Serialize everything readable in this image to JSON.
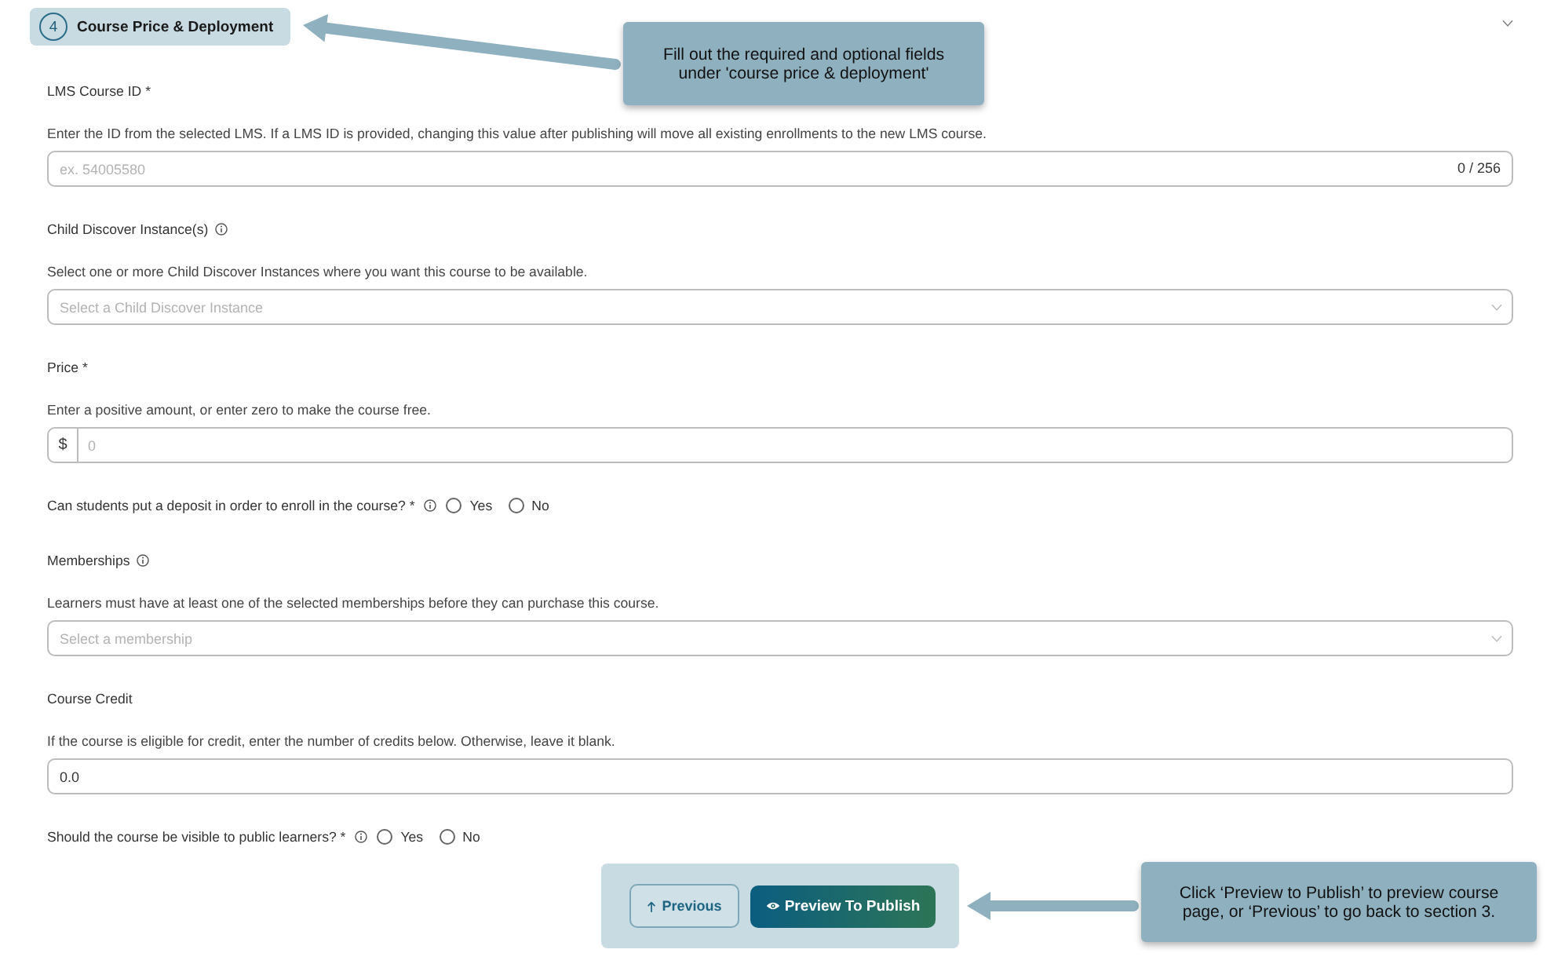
{
  "section": {
    "number": "4",
    "title": "Course Price & Deployment",
    "expanded": true
  },
  "fields": [
    {
      "kind": "text",
      "label": "LMS Course ID *",
      "info": false,
      "description": "Enter the ID from the selected LMS. If a LMS ID is provided, changing this value after publishing will move all existing enrollments to the new LMS course.",
      "placeholder": "ex. 54005580",
      "counter": "0 / 256"
    },
    {
      "kind": "select",
      "label": "Child Discover Instance(s)",
      "info": true,
      "description": "Select one or more Child Discover Instances where you want this course to be available.",
      "placeholder": "Select a Child Discover Instance"
    },
    {
      "kind": "currency",
      "label": "Price *",
      "info": false,
      "description": "Enter a positive amount, or enter zero to make the course free.",
      "prefix": "$",
      "placeholder": "0"
    },
    {
      "kind": "radio",
      "label": "Can students put a deposit in order to enroll in the course? *",
      "info": true,
      "options": [
        {
          "label": "Yes",
          "selected": false
        },
        {
          "label": "No",
          "selected": false
        }
      ]
    },
    {
      "kind": "select",
      "label": "Memberships",
      "info": true,
      "description": "Learners must have at least one of the selected memberships before they can purchase this course.",
      "placeholder": "Select a membership"
    },
    {
      "kind": "text",
      "label": "Course Credit",
      "info": false,
      "description": "If the course is eligible for credit, enter the number of credits below. Otherwise, leave it blank.",
      "value": "0.0"
    },
    {
      "kind": "radio",
      "label": "Should the course be visible to public learners? *",
      "info": true,
      "options": [
        {
          "label": "Yes",
          "selected": false
        },
        {
          "label": "No",
          "selected": false
        }
      ]
    }
  ],
  "buttons": [
    {
      "kind": "secondary",
      "label": "Previous"
    },
    {
      "kind": "primary",
      "label": "Preview To Publish"
    }
  ],
  "annotations": [
    {
      "text": "Fill out the required and optional fields under 'course price & deployment'"
    },
    {
      "text": "Click ‘Preview to Publish’ to preview course page, or ‘Previous’ to go back to section 3."
    }
  ]
}
